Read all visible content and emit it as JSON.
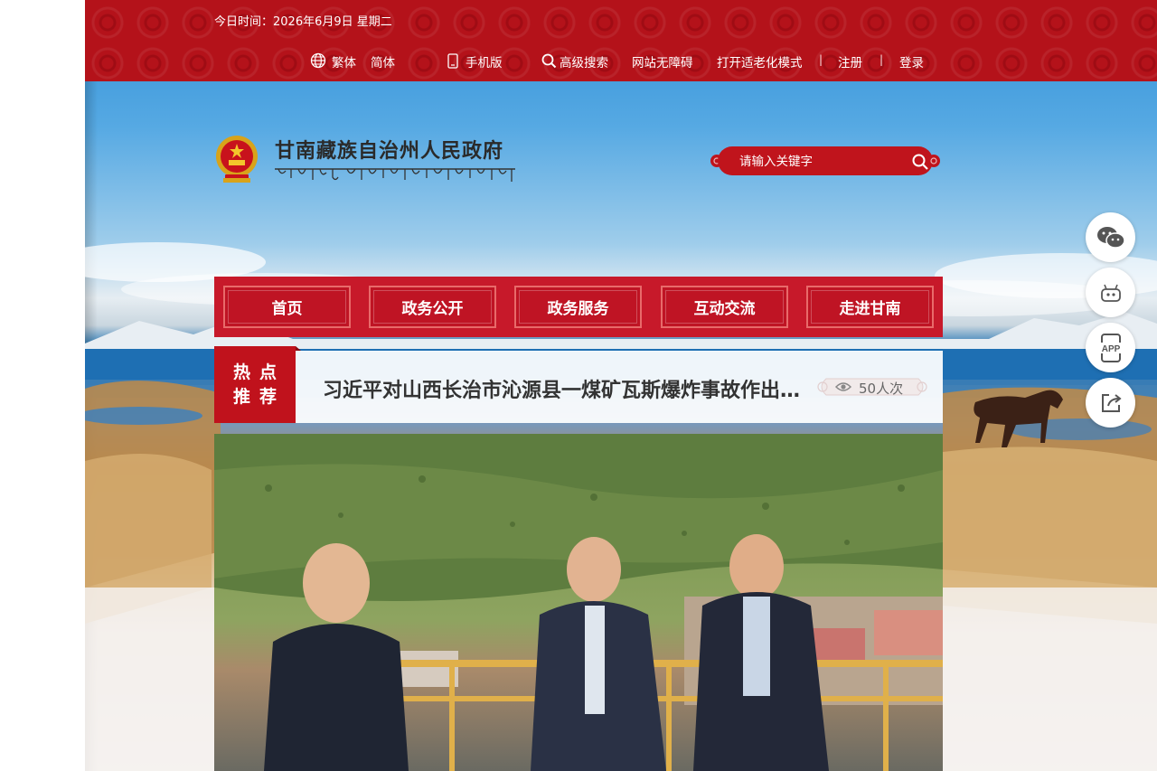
{
  "topbar": {
    "date_label": "今日时间：2026年6月9日  星期二",
    "traditional": "繁体",
    "simplified": "简体",
    "mobile": "手机版",
    "advanced_search": "高级搜索",
    "accessibility": "网站无障碍",
    "elder_mode": "打开适老化模式",
    "separator": "|",
    "register": "注册",
    "login": "登录"
  },
  "header": {
    "site_title": "甘南藏族自治州人民政府"
  },
  "search": {
    "placeholder": "请输入关键字"
  },
  "nav": {
    "items": [
      "首页",
      "政务公开",
      "政务服务",
      "互动交流",
      "走进甘南"
    ]
  },
  "hot": {
    "tag_line1": "热点",
    "tag_line2": "推荐",
    "title": "习近平对山西长治市沁源县一煤矿瓦斯爆炸事故作出重要指示",
    "views": "50人次"
  },
  "float_buttons": [
    "wechat-icon",
    "robot-icon",
    "app-icon",
    "share-icon"
  ],
  "colors": {
    "brand_red": "#c0121c",
    "nav_red": "#c7192a",
    "sky_blue": "#3a94d8"
  }
}
